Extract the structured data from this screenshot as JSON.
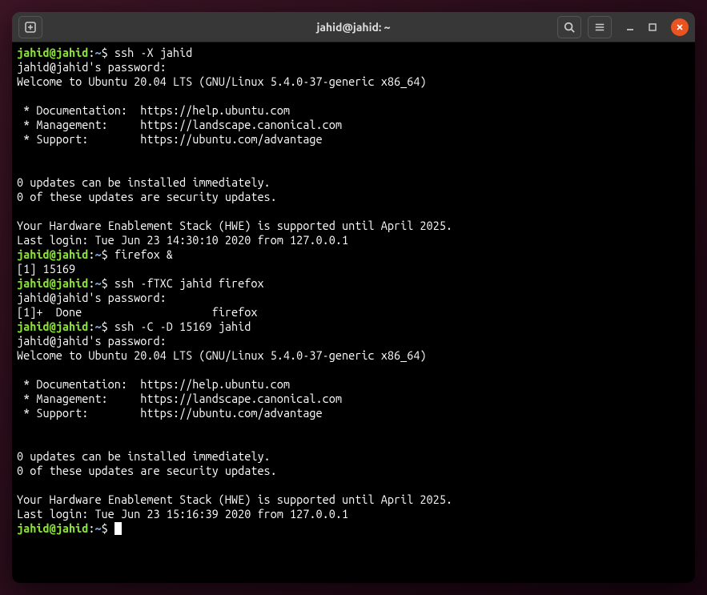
{
  "titlebar": {
    "title": "jahid@jahid: ~"
  },
  "prompt": {
    "user": "jahid",
    "host": "jahid",
    "path": "~",
    "symbol": "$"
  },
  "lines": [
    {
      "type": "prompt",
      "cmd": "ssh -X jahid"
    },
    {
      "type": "text",
      "text": "jahid@jahid's password:"
    },
    {
      "type": "text",
      "text": "Welcome to Ubuntu 20.04 LTS (GNU/Linux 5.4.0-37-generic x86_64)"
    },
    {
      "type": "text",
      "text": ""
    },
    {
      "type": "text",
      "text": " * Documentation:  https://help.ubuntu.com"
    },
    {
      "type": "text",
      "text": " * Management:     https://landscape.canonical.com"
    },
    {
      "type": "text",
      "text": " * Support:        https://ubuntu.com/advantage"
    },
    {
      "type": "text",
      "text": ""
    },
    {
      "type": "text",
      "text": ""
    },
    {
      "type": "text",
      "text": "0 updates can be installed immediately."
    },
    {
      "type": "text",
      "text": "0 of these updates are security updates."
    },
    {
      "type": "text",
      "text": ""
    },
    {
      "type": "text",
      "text": "Your Hardware Enablement Stack (HWE) is supported until April 2025."
    },
    {
      "type": "text",
      "text": "Last login: Tue Jun 23 14:30:10 2020 from 127.0.0.1"
    },
    {
      "type": "prompt",
      "cmd": "firefox &"
    },
    {
      "type": "text",
      "text": "[1] 15169"
    },
    {
      "type": "prompt",
      "cmd": "ssh -fTXC jahid firefox"
    },
    {
      "type": "text",
      "text": "jahid@jahid's password:"
    },
    {
      "type": "text",
      "text": "[1]+  Done                    firefox"
    },
    {
      "type": "prompt",
      "cmd": "ssh -C -D 15169 jahid"
    },
    {
      "type": "text",
      "text": "jahid@jahid's password:"
    },
    {
      "type": "text",
      "text": "Welcome to Ubuntu 20.04 LTS (GNU/Linux 5.4.0-37-generic x86_64)"
    },
    {
      "type": "text",
      "text": ""
    },
    {
      "type": "text",
      "text": " * Documentation:  https://help.ubuntu.com"
    },
    {
      "type": "text",
      "text": " * Management:     https://landscape.canonical.com"
    },
    {
      "type": "text",
      "text": " * Support:        https://ubuntu.com/advantage"
    },
    {
      "type": "text",
      "text": ""
    },
    {
      "type": "text",
      "text": ""
    },
    {
      "type": "text",
      "text": "0 updates can be installed immediately."
    },
    {
      "type": "text",
      "text": "0 of these updates are security updates."
    },
    {
      "type": "text",
      "text": ""
    },
    {
      "type": "text",
      "text": "Your Hardware Enablement Stack (HWE) is supported until April 2025."
    },
    {
      "type": "text",
      "text": "Last login: Tue Jun 23 15:16:39 2020 from 127.0.0.1"
    },
    {
      "type": "prompt",
      "cmd": "",
      "cursor": true
    }
  ]
}
